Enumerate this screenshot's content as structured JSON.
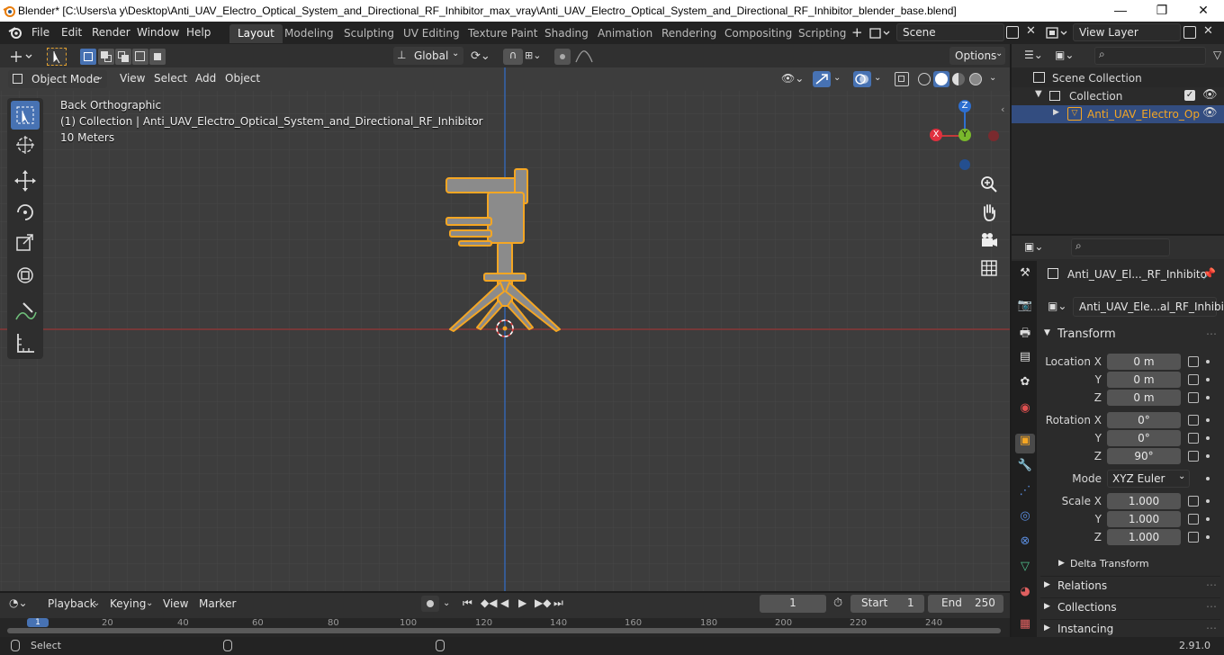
{
  "window": {
    "title": "Blender* [C:\\Users\\a y\\Desktop\\Anti_UAV_Electro_Optical_System_and_Directional_RF_Inhibitor_max_vray\\Anti_UAV_Electro_Optical_System_and_Directional_RF_Inhibitor_blender_base.blend]",
    "minimize": "—",
    "maximize": "❐",
    "close": "✕"
  },
  "menu": [
    "File",
    "Edit",
    "Render",
    "Window",
    "Help"
  ],
  "workspaces": [
    "Layout",
    "Modeling",
    "Sculpting",
    "UV Editing",
    "Texture Paint",
    "Shading",
    "Animation",
    "Rendering",
    "Compositing",
    "Scripting"
  ],
  "active_workspace": "Layout",
  "scene": "Scene",
  "view_layer": "View Layer",
  "viewport": {
    "transform_orientation": "Global",
    "options": "Options",
    "mode": "Object Mode",
    "header_menus": [
      "View",
      "Select",
      "Add",
      "Object"
    ],
    "view_name": "Back Orthographic",
    "collection_info": "(1) Collection | Anti_UAV_Electro_Optical_System_and_Directional_RF_Inhibitor",
    "scale_info": "10 Meters",
    "gizmo": {
      "x": "X",
      "y": "Y",
      "z": "Z"
    }
  },
  "outliner": {
    "scene_collection": "Scene Collection",
    "collection": "Collection",
    "object": "Anti_UAV_Electro_Op"
  },
  "properties": {
    "object_name": "Anti_UAV_El..._RF_Inhibito",
    "data_name": "Anti_UAV_Ele...al_RF_Inhibitor",
    "transform_header": "Transform",
    "location_label": "Location X",
    "rotation_label": "Rotation X",
    "scale_label": "Scale X",
    "y_label": "Y",
    "z_label": "Z",
    "location": [
      "0 m",
      "0 m",
      "0 m"
    ],
    "rotation": [
      "0°",
      "0°",
      "90°"
    ],
    "mode_label": "Mode",
    "mode_value": "XYZ Euler",
    "scale": [
      "1.000",
      "1.000",
      "1.000"
    ],
    "delta_transform": "Delta Transform",
    "relations": "Relations",
    "collections": "Collections",
    "instancing": "Instancing"
  },
  "timeline": {
    "menus": [
      "Playback",
      "Keying",
      "View",
      "Marker"
    ],
    "current_frame": "1",
    "start_label": "Start",
    "start": "1",
    "end_label": "End",
    "end": "250",
    "ticks": [
      "1",
      "20",
      "40",
      "60",
      "80",
      "100",
      "120",
      "140",
      "160",
      "180",
      "200",
      "220",
      "240"
    ]
  },
  "status": {
    "select": "Select",
    "version": "2.91.0"
  },
  "colors": {
    "accent": "#4772b3",
    "selection_outline": "#f5a623",
    "x_axis": "#c33a3a",
    "y_axis": "#6b9e1c",
    "z_axis": "#2e6fd0"
  }
}
